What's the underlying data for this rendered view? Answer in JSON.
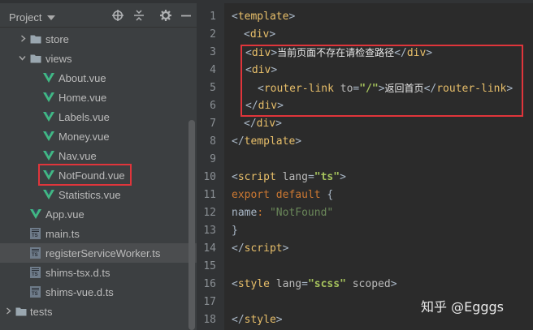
{
  "project_pane": {
    "title": "Project",
    "tree": [
      {
        "label": "store",
        "kind": "folder",
        "expanded": false,
        "indent": 1
      },
      {
        "label": "views",
        "kind": "folder",
        "expanded": true,
        "indent": 1
      },
      {
        "label": "About.vue",
        "kind": "vue",
        "indent": 2
      },
      {
        "label": "Home.vue",
        "kind": "vue",
        "indent": 2
      },
      {
        "label": "Labels.vue",
        "kind": "vue",
        "indent": 2
      },
      {
        "label": "Money.vue",
        "kind": "vue",
        "indent": 2
      },
      {
        "label": "Nav.vue",
        "kind": "vue",
        "indent": 2
      },
      {
        "label": "NotFound.vue",
        "kind": "vue",
        "indent": 2
      },
      {
        "label": "Statistics.vue",
        "kind": "vue",
        "indent": 2
      },
      {
        "label": "App.vue",
        "kind": "vue",
        "indent": 1
      },
      {
        "label": "main.ts",
        "kind": "ts",
        "indent": 1
      },
      {
        "label": "registerServiceWorker.ts",
        "kind": "ts",
        "indent": 1,
        "selected": true
      },
      {
        "label": "shims-tsx.d.ts",
        "kind": "ts",
        "indent": 1
      },
      {
        "label": "shims-vue.d.ts",
        "kind": "ts",
        "indent": 1
      },
      {
        "label": "tests",
        "kind": "folder",
        "expanded": false,
        "indent": 0
      }
    ]
  },
  "editor": {
    "line_numbers": [
      "1",
      "2",
      "3",
      "4",
      "5",
      "6",
      "7",
      "8",
      "9",
      "10",
      "11",
      "12",
      "13",
      "14",
      "15",
      "16",
      "17",
      "18"
    ],
    "l1_tag": "template",
    "l2_tag": "div",
    "l3_tag": "div",
    "l3_text": "当前页面不存在请检查路径",
    "l3_close": "div",
    "l4_tag": "div",
    "l5_tag": "router-link",
    "l5_attr": "to",
    "l5_value": "\"/\"",
    "l5_text": "返回首页",
    "l5_close": "router-link",
    "l6_tag": "div",
    "l7_tag": "div",
    "l8_tag": "template",
    "l10_tag": "script",
    "l10_attr": "lang",
    "l10_value": "\"ts\"",
    "l11_kw1": "export",
    "l11_kw2": "default",
    "l11_brace": "{",
    "l12_key": "name",
    "l12_value": "\"NotFound\"",
    "l13_brace": "}",
    "l14_tag": "script",
    "l16_tag": "style",
    "l16_attr": "lang",
    "l16_value": "\"scss\"",
    "l16_attr2": "scoped",
    "l18_tag": "style"
  },
  "watermark": "知乎 @Egggs",
  "colors": {
    "panel_bg": "#3c3f41",
    "editor_bg": "#2b2b2b",
    "vue_icon": "#41b883",
    "folder_icon": "#9aa7b0",
    "highlight_box": "#e0353b",
    "tag": "#e8bf6a",
    "string": "#a5c25c",
    "keyword": "#cc7832"
  },
  "icons": [
    "folder-icon",
    "vue-file-icon",
    "typescript-file-icon",
    "crosshair-icon",
    "collapse-all-icon",
    "gear-icon",
    "minimize-icon",
    "chevron-right-icon",
    "chevron-down-icon"
  ]
}
